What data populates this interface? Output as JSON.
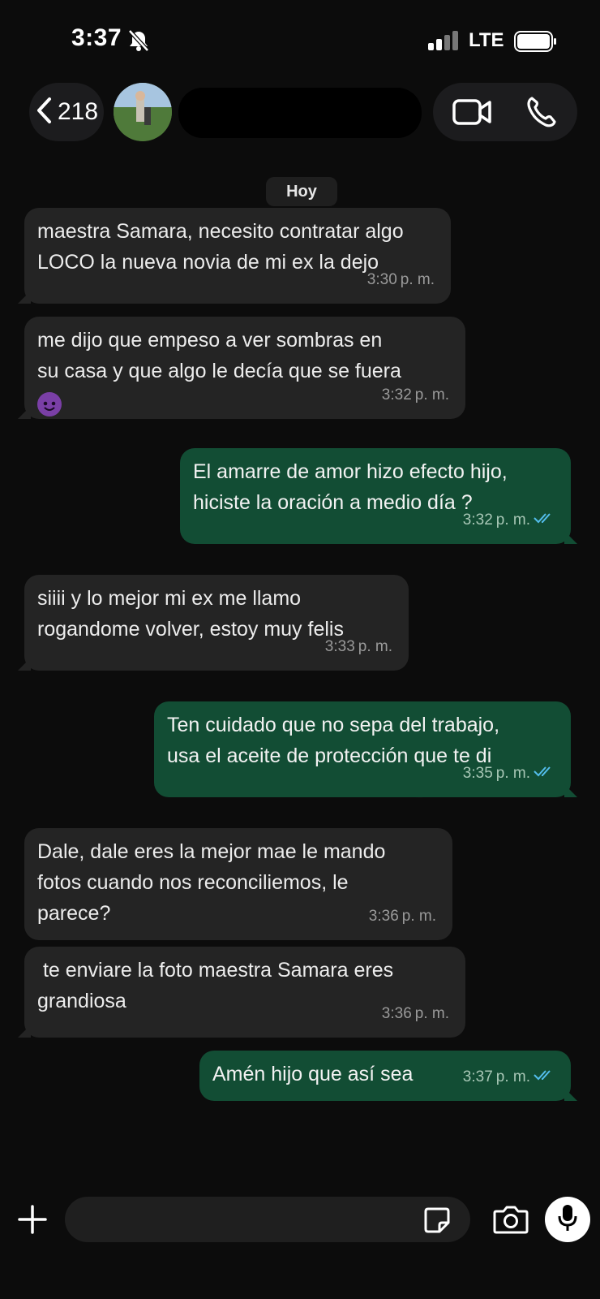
{
  "status_bar": {
    "time": "3:37",
    "carrier": "LTE"
  },
  "header": {
    "back_count": "218"
  },
  "date_chip": "Hoy",
  "messages": [
    {
      "dir": "in",
      "lines": [
        "maestra Samara, necesito contratar algo",
        "LOCO la nueva novia de mi ex la dejo"
      ],
      "time": "3:30",
      "ampm": "p. m."
    },
    {
      "dir": "in",
      "lines": [
        "me dijo que empeso a ver sombras en",
        "su casa y que algo le decía que se fuera"
      ],
      "emoji": "smiling-imp",
      "time": "3:32",
      "ampm": "p. m."
    },
    {
      "dir": "out",
      "lines": [
        "El amarre de amor hizo efecto hijo,",
        "hiciste la oración a medio día ?"
      ],
      "time": "3:32",
      "ampm": "p. m.",
      "read": true
    },
    {
      "dir": "in",
      "lines": [
        "siiii y lo mejor mi ex me llamo",
        "rogandome volver, estoy muy felis"
      ],
      "time": "3:33",
      "ampm": "p. m."
    },
    {
      "dir": "out",
      "lines": [
        "Ten cuidado que no sepa del trabajo,",
        "usa el aceite de protección que te di"
      ],
      "time": "3:35",
      "ampm": "p. m.",
      "read": true
    },
    {
      "dir": "in",
      "lines": [
        "Dale, dale eres la mejor mae le mando",
        "fotos cuando nos reconciliemos, le",
        "parece?"
      ],
      "time": "3:36",
      "ampm": "p. m."
    },
    {
      "dir": "in",
      "lines": [
        " te enviare la foto maestra Samara eres",
        "grandiosa"
      ],
      "time": "3:36",
      "ampm": "p. m."
    },
    {
      "dir": "out",
      "lines": [
        "Amén hijo que así sea"
      ],
      "time": "3:37",
      "ampm": "p. m.",
      "read": true
    }
  ],
  "colors": {
    "incoming_bubble": "#242424",
    "outgoing_bubble": "#124d34",
    "read_ticks": "#53bdeb"
  }
}
